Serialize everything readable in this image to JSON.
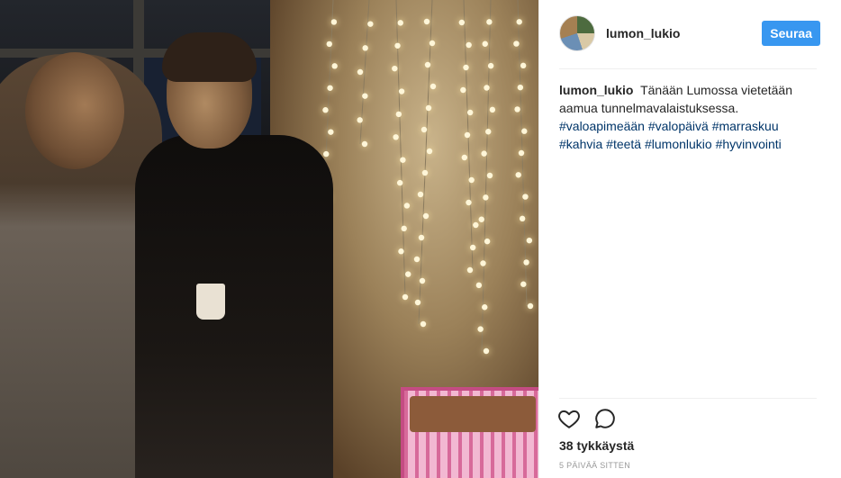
{
  "post": {
    "photo": {
      "description_icon": "photo-two-people-string-lights"
    },
    "header": {
      "username": "lumon_lukio",
      "follow_label": "Seuraa"
    },
    "caption": {
      "author": "lumon_lukio",
      "text": "Tänään Lumossa vietetään aamua tunnelmavalaistuksessa.",
      "hashtags": [
        "#valoapimeään",
        "#valopäivä",
        "#marraskuu",
        "#kahvia",
        "#teetä",
        "#lumonlukio",
        "#hyvinvointi"
      ]
    },
    "actions": {
      "like_icon": "heart-icon",
      "comment_icon": "comment-icon"
    },
    "likes": "38 tykkäystä",
    "timestamp": "5 PÄIVÄÄ SITTEN"
  },
  "colors": {
    "accent": "#3897f0",
    "hashtag": "#003569",
    "muted": "#999999",
    "text": "#262626"
  }
}
